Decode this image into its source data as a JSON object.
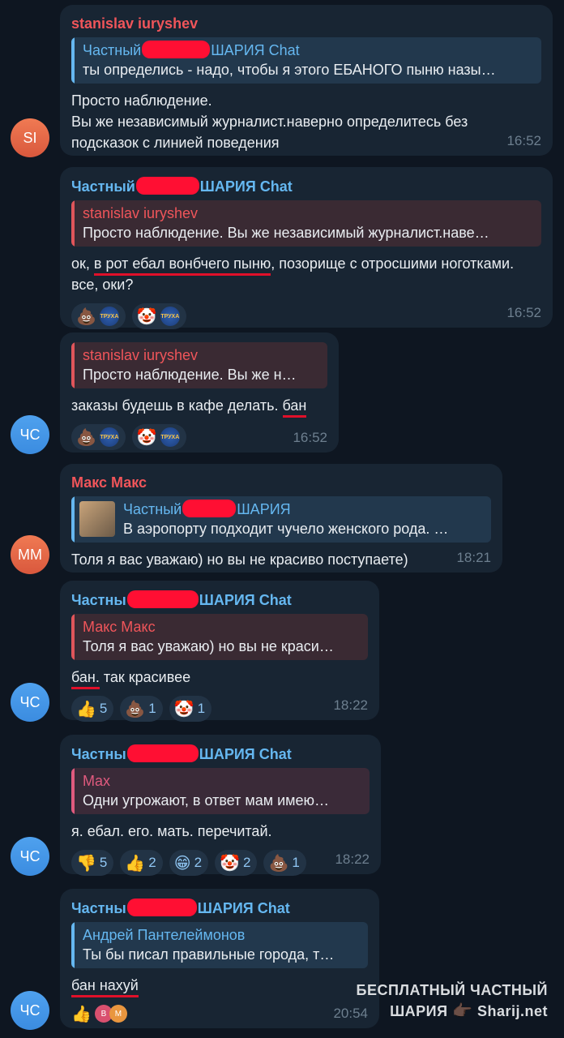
{
  "redacted_prefix": "Частный",
  "messages": [
    {
      "sender": "stanislav iuryshev",
      "avatar": "SI",
      "quote_name_pre": "Частный",
      "quote_name_post": "ШАРИЯ Chat",
      "quote_text": "ты определись - надо, чтобы я этого ЕБАНОГО пыню назы…",
      "text_line1": "Просто наблюдение.",
      "text_line2": "Вы же независимый журналист.наверно определитесь без подсказок с линией поведения",
      "time": "16:52"
    },
    {
      "sender_pre": "Частный",
      "sender_post": "ШАРИЯ Chat",
      "quote_name": "stanislav iuryshev",
      "quote_text": "Просто наблюдение. Вы же независимый журналист.наве…",
      "text_pre": "ок, ",
      "text_ul": "в рот ебал вонбчего пыню",
      "text_post": ", позорище с отросшими ноготками. все, оки?",
      "time": "16:52",
      "reactions": [
        {
          "icon": "poop-emoji",
          "glyph": "💩",
          "truha": "ТРУХА"
        },
        {
          "icon": "clown-emoji",
          "glyph": "🤡",
          "truha": "ТРУХА"
        }
      ]
    },
    {
      "avatar": "ЧС",
      "quote_name": "stanislav iuryshev",
      "quote_text": "Просто наблюдение. Вы же н…",
      "text_pre": "заказы будешь в кафе делать. ",
      "text_ul": "бан",
      "time": "16:52",
      "reactions": [
        {
          "icon": "poop-emoji",
          "glyph": "💩",
          "truha": "ТРУХА"
        },
        {
          "icon": "clown-emoji",
          "glyph": "🤡",
          "truha": "ТРУХА"
        }
      ]
    },
    {
      "sender": "Макс Макс",
      "avatar": "ММ",
      "quote_name_pre": "Частный",
      "quote_name_post": "ШАРИЯ",
      "quote_text": "В аэропорту подходит чучело женского рода. …",
      "text": "Толя я вас уважаю) но вы не красиво поступаете)",
      "time": "18:21"
    },
    {
      "avatar": "ЧС",
      "sender_pre": "Частны",
      "sender_post": "ШАРИЯ Chat",
      "quote_name": "Макс Макс",
      "quote_text": "Толя я вас уважаю) но вы не краси…",
      "text_ul": "бан.",
      "text_post": " так красивее",
      "time": "18:22",
      "reactions": [
        {
          "icon": "thumbs-up-emoji",
          "glyph": "👍",
          "count": "5"
        },
        {
          "icon": "poop-emoji",
          "glyph": "💩",
          "count": "1"
        },
        {
          "icon": "clown-emoji",
          "glyph": "🤡",
          "count": "1"
        }
      ]
    },
    {
      "avatar": "ЧС",
      "sender_pre": "Частны",
      "sender_post": "ШАРИЯ Chat",
      "quote_name": "Max",
      "quote_text": "Одни угрожают, в ответ мам имею…",
      "text": "я. ебал. его. мать. перечитай.",
      "time": "18:22",
      "reactions": [
        {
          "icon": "thumbs-down-emoji",
          "glyph": "👎",
          "count": "5"
        },
        {
          "icon": "thumbs-up-emoji",
          "glyph": "👍",
          "count": "2"
        },
        {
          "icon": "grin-emoji",
          "glyph": "😁",
          "count": "2"
        },
        {
          "icon": "clown-emoji",
          "glyph": "🤡",
          "count": "2"
        },
        {
          "icon": "poop-emoji",
          "glyph": "💩",
          "count": "1"
        }
      ]
    },
    {
      "avatar": "ЧС",
      "sender_pre": "Частны",
      "sender_post": "ШАРИЯ Chat",
      "quote_name": "Андрей Пантелеймонов",
      "quote_text": "Ты бы писал правильные города, т…",
      "text_ul": "бан нахуй",
      "time": "20:54",
      "reaction": {
        "icon": "thumbs-up-emoji",
        "glyph": "👍",
        "av1": "B",
        "av2": "M"
      }
    }
  ],
  "watermark": {
    "line1": "БЕСПЛАТНЫЙ ЧАСТНЫЙ",
    "line2_a": "ШАРИЯ",
    "line2_glyph": "👉🏿",
    "line2_b": "Sharij.net"
  }
}
